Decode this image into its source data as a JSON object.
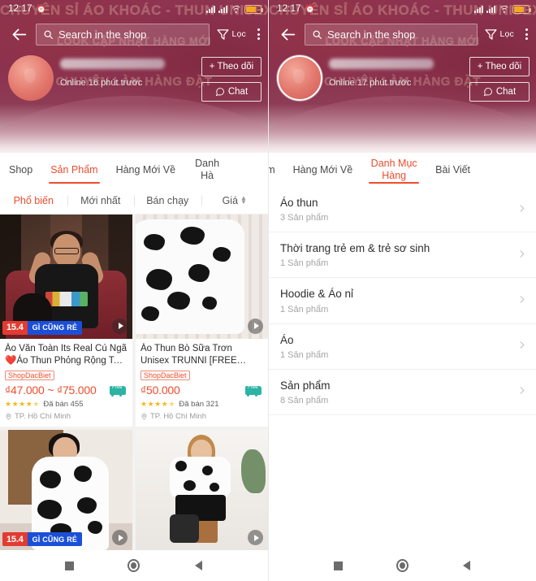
{
  "status_bar": {
    "time": "12:17",
    "alarm_icon": "alarm-icon",
    "signal_icon": "signal-bars-icon",
    "wifi_icon": "wifi-icon",
    "battery_icon": "battery-icon"
  },
  "banner": {
    "ghost_line_1": "CHUYÊN SỈ ÁO KHOÁC - THUN UNISEX",
    "ghost_line_2": "LOOK CẬP NHẬT HÀNG MỚI",
    "ghost_line_3": "CHUYÊN LÀM HÀNG ĐẶT"
  },
  "search": {
    "placeholder": "Search in the shop",
    "search_icon": "search-icon",
    "back_icon": "back-arrow-icon",
    "filter_label": "Lọc",
    "filter_icon": "funnel-icon",
    "more_icon": "more-vertical-icon"
  },
  "left": {
    "shop": {
      "online_text": "Online 16 phút trước",
      "follow_label": "+ Theo dõi",
      "chat_label": "Chat",
      "chat_icon": "chat-bubble-icon"
    },
    "tabs": [
      {
        "label": "Shop",
        "active": false
      },
      {
        "label": "Sản Phẩm",
        "active": true
      },
      {
        "label": "Hàng Mới Về",
        "active": false
      },
      {
        "label": "Danh Hà",
        "active": false
      }
    ],
    "subfilters": [
      {
        "label": "Phổ biến",
        "active": true
      },
      {
        "label": "Mới nhất",
        "active": false
      },
      {
        "label": "Bán chạy",
        "active": false
      },
      {
        "label": "Giá",
        "active": false,
        "has_caret": true
      }
    ],
    "products": [
      {
        "title": "Áo Văn Toàn Its Real Cú Ngã ❤️Áo Thun Phỏng Rộng Tay ...",
        "tag": "ShopDacBiet",
        "price": "₫47.000 ~ ₫75.000",
        "rating": 4.5,
        "sold": "Đã bán 455",
        "location": "TP. Hồ Chí Minh",
        "promo_date": "15.4",
        "promo_text": "GÌ CŨNG RẺ",
        "free_ship": "Free",
        "has_video": true,
        "photo": "woman-black-tshirt-with-dog"
      },
      {
        "title": "Áo Thun Bò Sữa Trơn Unisex TRUNNI [FREE SHIP] 🌸 Phồ...",
        "tag": "ShopDacBiet",
        "price": "₫50.000",
        "rating": 4.5,
        "sold": "Đã bán 321",
        "location": "TP. Hồ Chí Minh",
        "promo_date": "",
        "promo_text": "",
        "free_ship": "Free",
        "has_video": true,
        "photo": "cow-print-tshirt"
      },
      {
        "title": "",
        "tag": "",
        "price": "",
        "rating": 0,
        "sold": "",
        "location": "",
        "promo_date": "15.4",
        "promo_text": "GÌ CŨNG RẺ",
        "free_ship": "",
        "has_video": true,
        "photo": "cow-print-hoodie"
      },
      {
        "title": "",
        "tag": "",
        "price": "",
        "rating": 0,
        "sold": "",
        "location": "",
        "promo_date": "",
        "promo_text": "",
        "free_ship": "",
        "has_video": true,
        "photo": "cow-print-top-sitting"
      }
    ]
  },
  "right": {
    "shop": {
      "online_text": "Online 17 phút trước",
      "follow_label": "+ Theo dõi",
      "chat_label": "Chat",
      "chat_icon": "chat-bubble-icon"
    },
    "tabs": [
      {
        "label": "Phẩm",
        "active": false
      },
      {
        "label": "Hàng Mới Về",
        "active": false
      },
      {
        "label": "Danh Mục Hàng",
        "active": true
      },
      {
        "label": "Bài Viết",
        "active": false
      }
    ],
    "categories": [
      {
        "name": "Áo thun",
        "count": "3 Sản phẩm"
      },
      {
        "name": "Thời trang trẻ em & trẻ sơ sinh",
        "count": "1 Sản phẩm"
      },
      {
        "name": "Hoodie & Áo nỉ",
        "count": "1 Sản phẩm"
      },
      {
        "name": "Áo",
        "count": "1 Sản phẩm"
      },
      {
        "name": "Sản phẩm",
        "count": "8 Sản phẩm"
      }
    ],
    "chevron_icon": "chevron-right-icon"
  },
  "navbar": {
    "recents_icon": "square-recents-icon",
    "home_icon": "circle-home-icon",
    "back_icon": "triangle-back-icon"
  },
  "colors": {
    "accent": "#ee4d2d",
    "banner": "#8e3350",
    "promo_red": "#e23b30",
    "promo_blue": "#1b4fd8",
    "star": "#f5b919",
    "ship_teal": "#2bb3a3"
  }
}
